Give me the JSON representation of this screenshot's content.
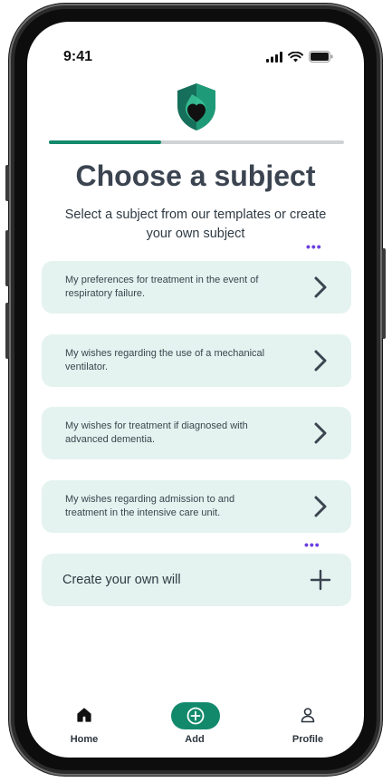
{
  "status_bar": {
    "time": "9:41",
    "icons": [
      "signal-icon",
      "wifi-icon",
      "battery-icon"
    ]
  },
  "progress": {
    "fraction": 0.38,
    "color": "#13896c"
  },
  "header": {
    "title": "Choose a subject",
    "subtitle": "Select a subject from our templates or create your own subject"
  },
  "templates": [
    {
      "label": "My preferences for treatment in the event of respiratory failure."
    },
    {
      "label": "My wishes regarding the use of a mechanical ventilator."
    },
    {
      "label": "My wishes for treatment if diagnosed with advanced dementia."
    },
    {
      "label": "My wishes regarding admission to and treatment in the intensive care unit."
    }
  ],
  "create_own": {
    "label": "Create your own will",
    "icon": "plus-icon"
  },
  "tab_bar": {
    "items": [
      {
        "label": "Home",
        "icon": "home-icon"
      },
      {
        "label": "Add",
        "icon": "add-circle-icon"
      },
      {
        "label": "Profile",
        "icon": "profile-icon"
      }
    ]
  },
  "colors": {
    "accent": "#13896c",
    "card_bg": "#e4f3ef",
    "title": "#3b4450",
    "dots": "#6a3ee0"
  }
}
